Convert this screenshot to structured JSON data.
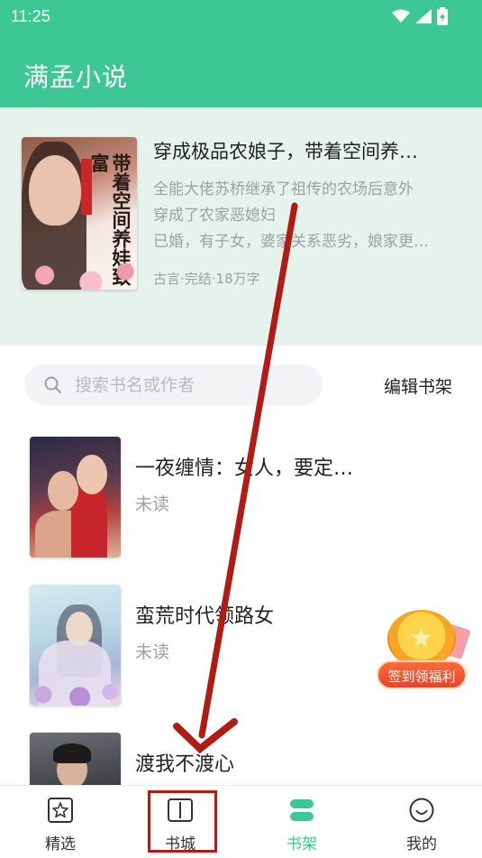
{
  "status_bar": {
    "time": "11:25"
  },
  "app": {
    "title": "满孟小说"
  },
  "featured": {
    "title": "穿成极品农娘子，带着空间养…",
    "description_lines": [
      "全能大佬苏桥继承了祖传的农场后意外",
      "穿成了农家恶媳妇",
      "已婚，有子女，婆家关系恶劣，娘家更…"
    ],
    "meta": "古言·完结·18万字",
    "cover_text": "带着空间养娃致富"
  },
  "search": {
    "placeholder": "搜索书名或作者",
    "edit_label": "编辑书架"
  },
  "books": [
    {
      "title": "一夜缠情：女人，要定…",
      "status": "未读"
    },
    {
      "title": "蛮荒时代领路女",
      "status": "未读"
    },
    {
      "title": "渡我不渡心",
      "status": ""
    }
  ],
  "reward": {
    "label": "签到领福利"
  },
  "nav": [
    {
      "label": "精选",
      "icon": "star-icon"
    },
    {
      "label": "书城",
      "icon": "book-icon"
    },
    {
      "label": "书架",
      "icon": "shelf-icon",
      "active": true
    },
    {
      "label": "我的",
      "icon": "profile-icon"
    }
  ],
  "colors": {
    "accent": "#3dc795",
    "annotation": "#b01b14"
  }
}
